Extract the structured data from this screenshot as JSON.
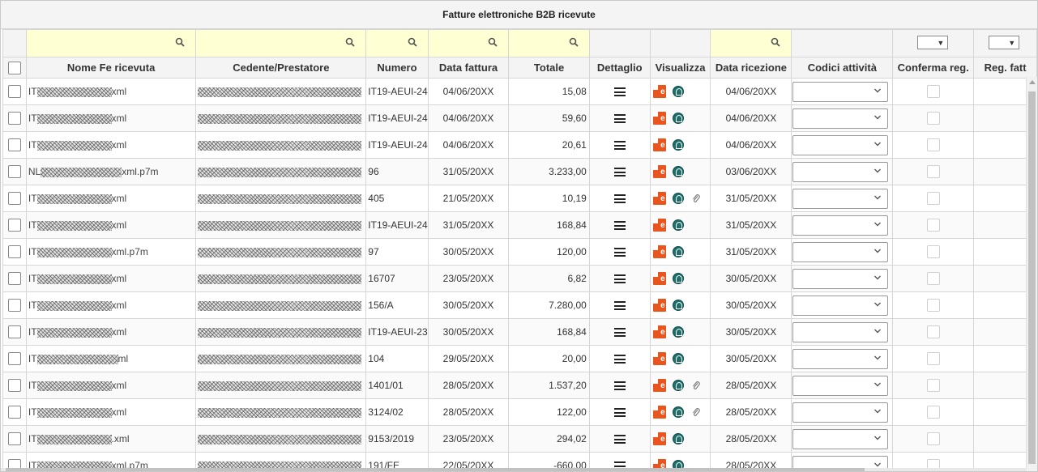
{
  "title": "Fatture elettroniche B2B ricevute",
  "columns": [
    "Nome Fe ricevuta",
    "Cedente/Prestatore",
    "Numero",
    "Data fattura",
    "Totale",
    "Dettaglio",
    "Visualizza",
    "Data ricezione",
    "Codici attività",
    "Conferma reg.",
    "Reg. fatt"
  ],
  "filters": {
    "select_caret": "▼"
  },
  "rows": [
    {
      "pre": "IT",
      "post": "xml",
      "numero": "IT19-AEUI-24",
      "data": "04/06/20XX",
      "totale": "15,08",
      "ricezione": "04/06/20XX",
      "clip": false
    },
    {
      "pre": "IT",
      "post": "xml",
      "numero": "IT19-AEUI-24",
      "data": "04/06/20XX",
      "totale": "59,60",
      "ricezione": "04/06/20XX",
      "clip": false
    },
    {
      "pre": "IT",
      "post": "xml",
      "numero": "IT19-AEUI-24",
      "data": "04/06/20XX",
      "totale": "20,61",
      "ricezione": "04/06/20XX",
      "clip": false
    },
    {
      "pre": "NL",
      "post": "xml.p7m",
      "numero": "96",
      "data": "31/05/20XX",
      "totale": "3.233,00",
      "ricezione": "03/06/20XX",
      "clip": false
    },
    {
      "pre": "IT",
      "post": "xml",
      "numero": "405",
      "data": "21/05/20XX",
      "totale": "10,19",
      "ricezione": "31/05/20XX",
      "clip": true
    },
    {
      "pre": "IT",
      "post": "xml",
      "numero": "IT19-AEUI-24",
      "data": "31/05/20XX",
      "totale": "168,84",
      "ricezione": "31/05/20XX",
      "clip": false
    },
    {
      "pre": "IT",
      "post": "xml.p7m",
      "numero": "97",
      "data": "30/05/20XX",
      "totale": "120,00",
      "ricezione": "31/05/20XX",
      "clip": false
    },
    {
      "pre": "IT",
      "post": "xml",
      "numero": "16707",
      "data": "23/05/20XX",
      "totale": "6,82",
      "ricezione": "30/05/20XX",
      "clip": false
    },
    {
      "pre": "IT",
      "post": "xml",
      "numero": "156/A",
      "data": "30/05/20XX",
      "totale": "7.280,00",
      "ricezione": "30/05/20XX",
      "clip": false
    },
    {
      "pre": "IT",
      "post": "xml",
      "numero": "IT19-AEUI-23",
      "data": "30/05/20XX",
      "totale": "168,84",
      "ricezione": "30/05/20XX",
      "clip": false
    },
    {
      "pre": "IT",
      "post": "ml",
      "numero": "104",
      "data": "29/05/20XX",
      "totale": "20,00",
      "ricezione": "30/05/20XX",
      "clip": false
    },
    {
      "pre": "IT",
      "post": "xml",
      "numero": "1401/01",
      "data": "28/05/20XX",
      "totale": "1.537,20",
      "ricezione": "28/05/20XX",
      "clip": true
    },
    {
      "pre": "IT",
      "post": "xml",
      "numero": "3124/02",
      "data": "28/05/20XX",
      "totale": "122,00",
      "ricezione": "28/05/20XX",
      "clip": true
    },
    {
      "pre": "IT",
      "post": ".xml",
      "numero": "9153/2019",
      "data": "23/05/20XX",
      "totale": "294,02",
      "ricezione": "28/05/20XX",
      "clip": false
    },
    {
      "pre": "IT",
      "post": "xml.p7m",
      "numero": "191/FE",
      "data": "22/05/20XX",
      "totale": "-660,00",
      "ricezione": "28/05/20XX",
      "clip": false
    }
  ],
  "icons": {
    "fe_badge": "fe-file-icon",
    "view": "eye-circle-icon",
    "attachment": "paperclip-icon",
    "detail": "hamburger-menu-icon"
  }
}
